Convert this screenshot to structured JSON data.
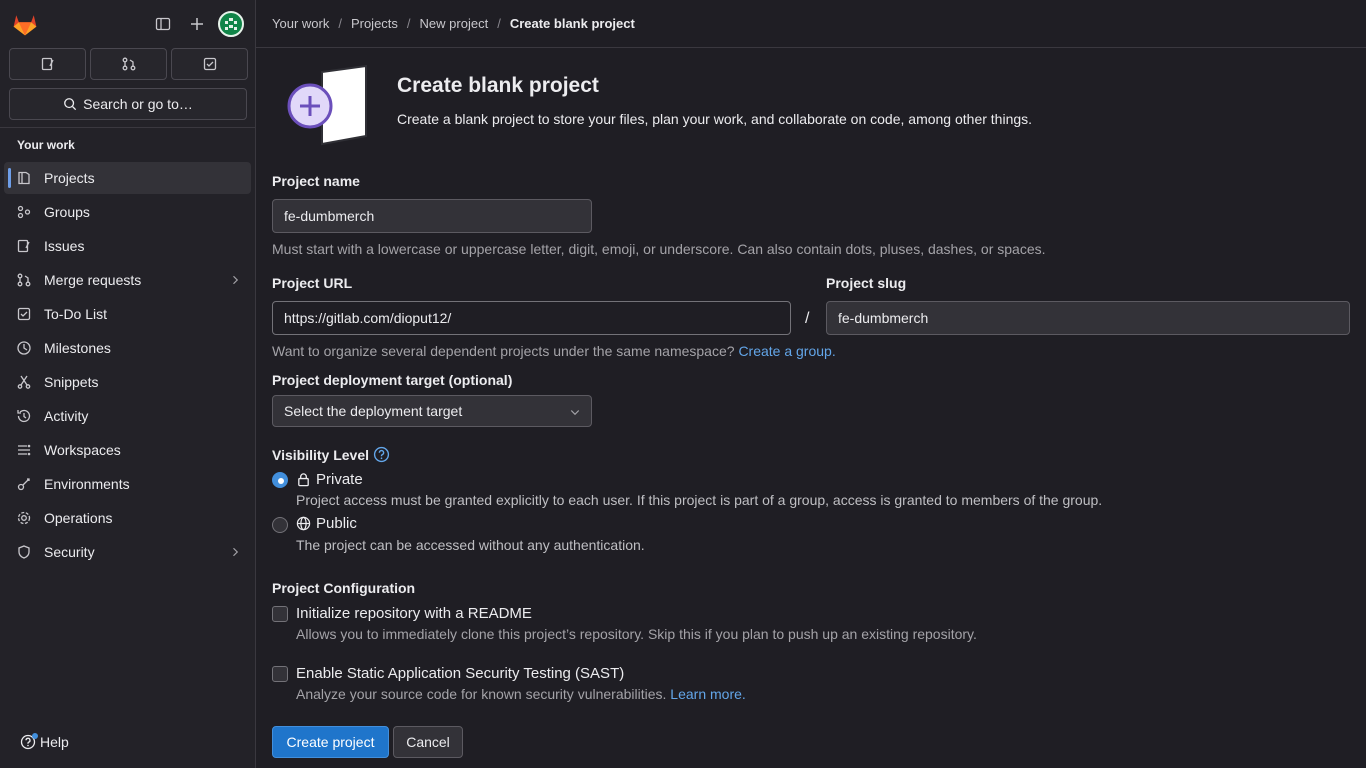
{
  "sidebar": {
    "search_label": "Search or go to…",
    "section_title": "Your work",
    "items": [
      {
        "label": "Projects",
        "icon": "project-icon",
        "active": true
      },
      {
        "label": "Groups",
        "icon": "group-icon"
      },
      {
        "label": "Issues",
        "icon": "issues-icon"
      },
      {
        "label": "Merge requests",
        "icon": "merge-request-icon",
        "has_children": true
      },
      {
        "label": "To-Do List",
        "icon": "todo-icon"
      },
      {
        "label": "Milestones",
        "icon": "milestone-icon"
      },
      {
        "label": "Snippets",
        "icon": "snippet-icon"
      },
      {
        "label": "Activity",
        "icon": "history-icon"
      },
      {
        "label": "Workspaces",
        "icon": "workspace-icon"
      },
      {
        "label": "Environments",
        "icon": "environment-icon"
      },
      {
        "label": "Operations",
        "icon": "operations-icon"
      },
      {
        "label": "Security",
        "icon": "shield-icon",
        "has_children": true
      }
    ],
    "help_label": "Help"
  },
  "breadcrumb": {
    "items": [
      "Your work",
      "Projects",
      "New project",
      "Create blank project"
    ]
  },
  "hero": {
    "title": "Create blank project",
    "description": "Create a blank project to store your files, plan your work, and collaborate on code, among other things."
  },
  "form": {
    "project_name_label": "Project name",
    "project_name_value": "fe-dumbmerch",
    "project_name_help": "Must start with a lowercase or uppercase letter, digit, emoji, or underscore. Can also contain dots, pluses, dashes, or spaces.",
    "project_url_label": "Project URL",
    "project_url_value": "https://gitlab.com/dioput12/",
    "url_separator": "/",
    "project_slug_label": "Project slug",
    "project_slug_value": "fe-dumbmerch",
    "namespace_help": "Want to organize several dependent projects under the same namespace?",
    "namespace_link": "Create a group.",
    "deployment_label": "Project deployment target (optional)",
    "deployment_value": "Select the deployment target",
    "visibility_label": "Visibility Level",
    "visibility": {
      "private_label": "Private",
      "private_desc": "Project access must be granted explicitly to each user. If this project is part of a group, access is granted to members of the group.",
      "public_label": "Public",
      "public_desc": "The project can be accessed without any authentication.",
      "selected": "Private"
    },
    "config_label": "Project Configuration",
    "readme_label": "Initialize repository with a README",
    "readme_desc": "Allows you to immediately clone this project’s repository. Skip this if you plan to push up an existing repository.",
    "sast_label": "Enable Static Application Security Testing (SAST)",
    "sast_desc": "Analyze your source code for known security vulnerabilities.",
    "sast_link": "Learn more.",
    "create_button": "Create project",
    "cancel_button": "Cancel"
  },
  "colors": {
    "accent": "#1f75cb",
    "link": "#63a6e9",
    "background": "#1f1e24",
    "illustration_purple": "#6b4fbb"
  }
}
